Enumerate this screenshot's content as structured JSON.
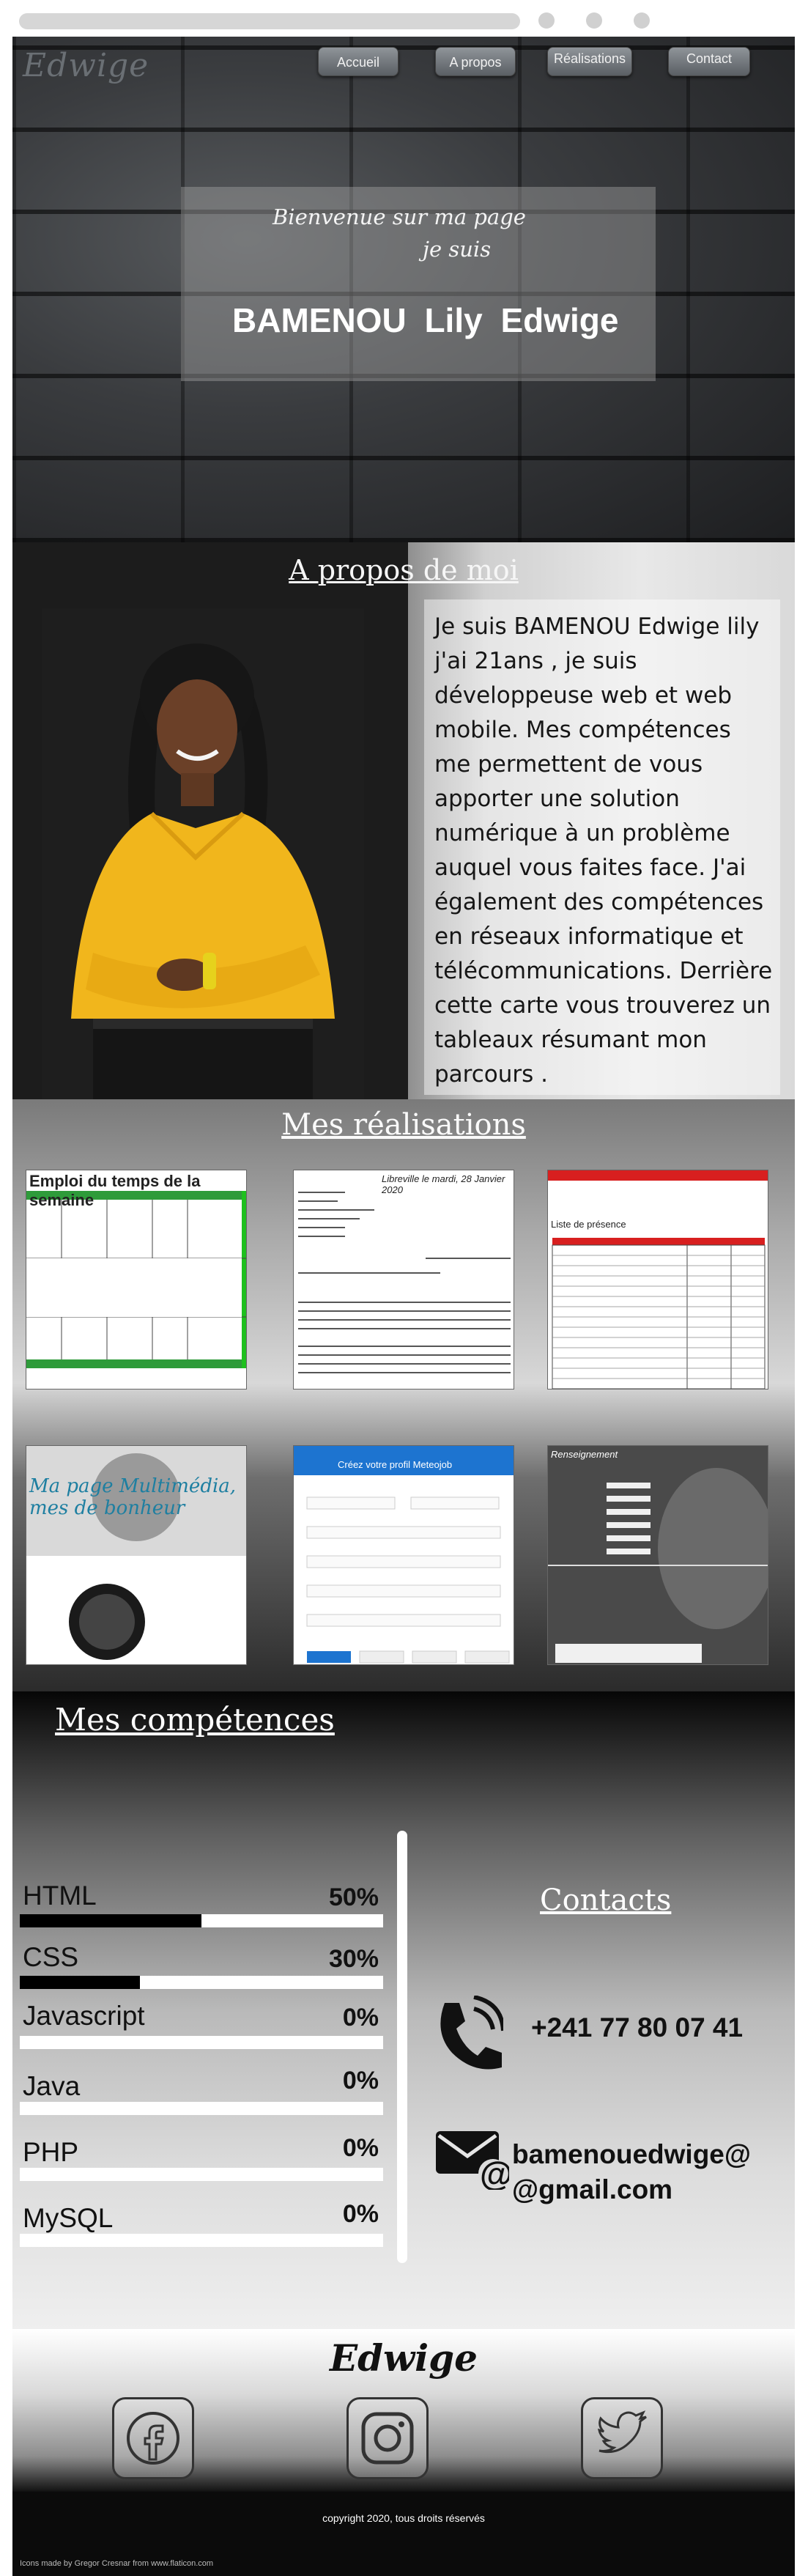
{
  "nav": {
    "logo": "Edwige",
    "items": [
      {
        "label": "Accueil"
      },
      {
        "label": "A propos"
      },
      {
        "label": "Réalisations"
      },
      {
        "label": "Contact"
      }
    ]
  },
  "hero": {
    "welcome_line1": "Bienvenue  sur ma page",
    "welcome_line2": "je suis",
    "name": "BAMENOU  Lily  Edwige"
  },
  "about": {
    "title": "A propos de moi",
    "text": "Je suis  BAMENOU Edwige lily  j'ai 21ans , je suis développeuse web et web mobile. Mes compétences me permettent de vous apporter une solution numérique à un problème auquel vous faites face. J'ai également des compétences en réseaux informatique et télécommunications. Derrière cette carte vous trouverez un tableaux résumant mon parcours ."
  },
  "realisations": {
    "title": "Mes réalisations",
    "thumbs": [
      {
        "caption": "Emploi du temps de la semaine"
      },
      {
        "caption": "Libreville le mardi, 28 Janvier 2020"
      },
      {
        "caption": "Liste de présence"
      },
      {
        "caption": "Ma page Multimédia, mes de bonheur"
      },
      {
        "caption": "Créez votre profil Meteojob"
      },
      {
        "caption": "Renseignement"
      }
    ]
  },
  "competences": {
    "title": "Mes compétences",
    "skills": [
      {
        "name": "HTML",
        "pct": "50%",
        "value": 0.5
      },
      {
        "name": "CSS",
        "pct": "30%",
        "value": 0.33
      },
      {
        "name": "Javascript",
        "pct": "0%",
        "value": 0
      },
      {
        "name": "Java",
        "pct": "0%",
        "value": 0
      },
      {
        "name": "PHP",
        "pct": "0%",
        "value": 0
      },
      {
        "name": "MySQL",
        "pct": "0%",
        "value": 0
      }
    ]
  },
  "contacts": {
    "title": "Contacts",
    "phone": "+241 77 80 07 41",
    "email": "bamenouedwige@ @gmail.com",
    "phone_icon": "phone-icon",
    "email_icon": "envelope-at-icon"
  },
  "footer": {
    "name": "Edwige",
    "socials": [
      "facebook-icon",
      "instagram-icon",
      "twitter-icon"
    ],
    "copyright": "copyright  2020, tous droits réservés",
    "credits": "Icons made by  Gregor Cresnar  from  www.flaticon.com"
  }
}
